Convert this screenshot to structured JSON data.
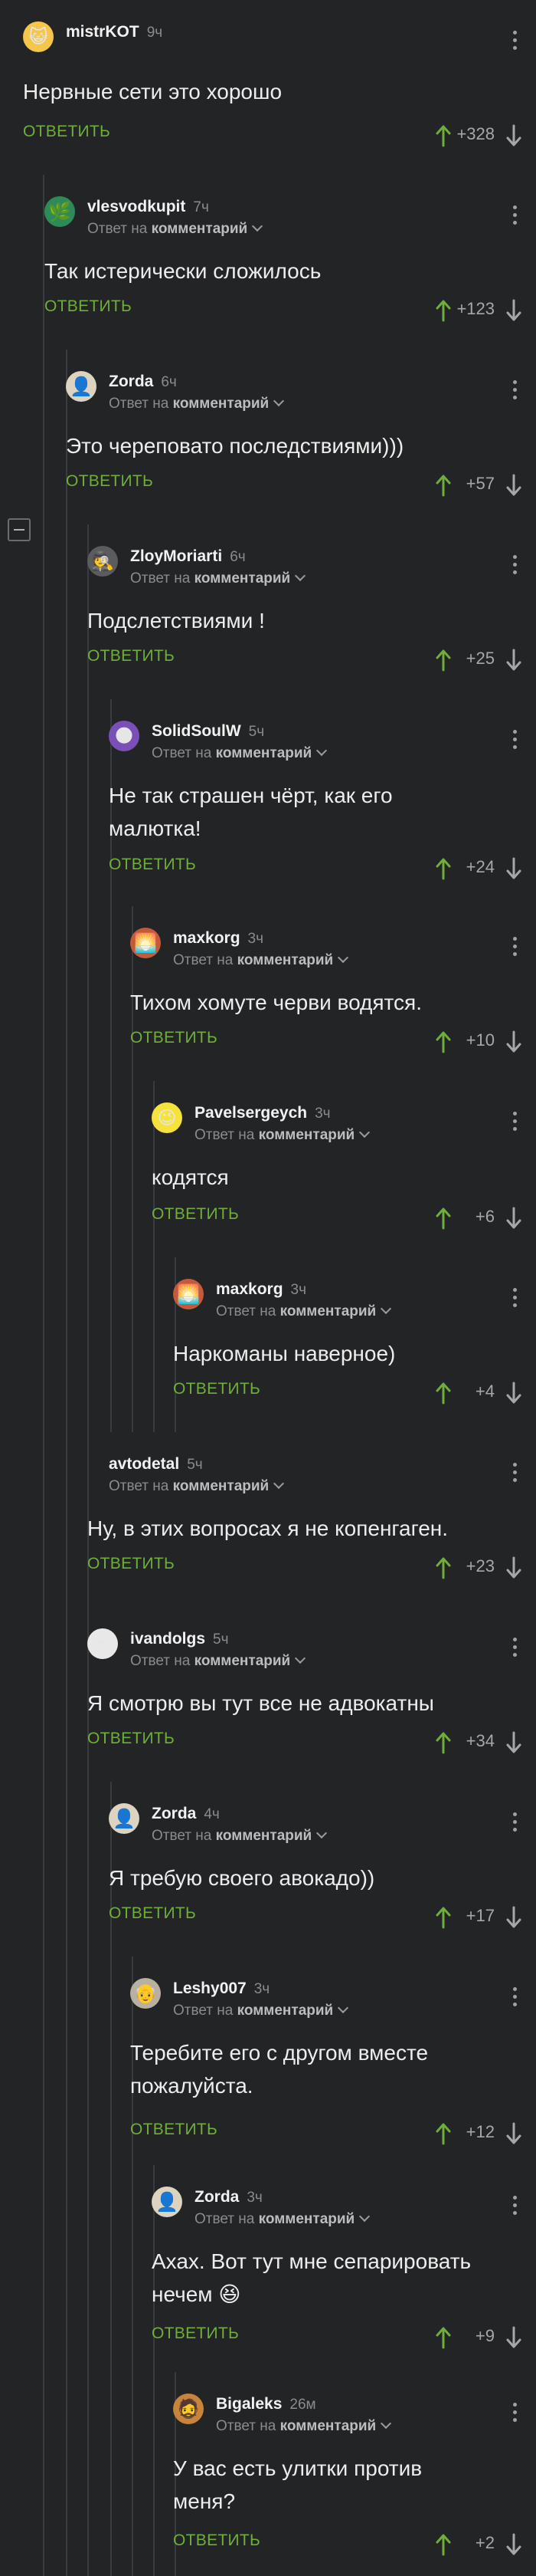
{
  "ui": {
    "reply_label": "ОТВЕТИТЬ",
    "reply_prefix": "Ответ на",
    "reply_target": "комментарий",
    "accent_color": "#6fae3a"
  },
  "comments": [
    {
      "user": "mistrKOT",
      "time": "9ч",
      "text": "Нервные сети это хорошо",
      "score": "+328",
      "reply_line": false
    },
    {
      "user": "vlesvodkupit",
      "time": "7ч",
      "text": "Так истерически сложилось",
      "score": "+123",
      "reply_line": true
    },
    {
      "user": "Zorda",
      "time": "6ч",
      "text": "Это череповато последствиями)))",
      "score": "+57",
      "reply_line": true
    },
    {
      "user": "ZloyMoriarti",
      "time": "6ч",
      "text": "Подслетствиями !",
      "score": "+25",
      "reply_line": true
    },
    {
      "user": "SolidSoulW",
      "time": "5ч",
      "text": "Не так страшен чёрт, как его малютка!",
      "score": "+24",
      "reply_line": true
    },
    {
      "user": "maxkorg",
      "time": "3ч",
      "text": "Тихом хомуте черви водятся.",
      "score": "+10",
      "reply_line": true
    },
    {
      "user": "Pavelsergeych",
      "time": "3ч",
      "text": "кодятся",
      "score": "+6",
      "reply_line": true
    },
    {
      "user": "maxkorg",
      "time": "3ч",
      "text": "Наркоманы наверное)",
      "score": "+4",
      "reply_line": true
    },
    {
      "user": "avtodetal",
      "time": "5ч",
      "text": "Ну, в этих вопросах я не копенгаген.",
      "score": "+23",
      "reply_line": true
    },
    {
      "user": "ivandolgs",
      "time": "5ч",
      "text": "Я смотрю вы тут все не адвокатны",
      "score": "+34",
      "reply_line": true
    },
    {
      "user": "Zorda",
      "time": "4ч",
      "text": "Я требую своего авокадо))",
      "score": "+17",
      "reply_line": true
    },
    {
      "user": "Leshy007",
      "time": "3ч",
      "text": "Теребите его с другом вместе пожалуйста.",
      "score": "+12",
      "reply_line": true
    },
    {
      "user": "Zorda",
      "time": "3ч",
      "text": "Ахах. Вот тут мне сепарировать нечем 😆",
      "score": "+9",
      "reply_line": true
    },
    {
      "user": "Bigaleks",
      "time": "26м",
      "text": "У вас есть улитки против меня?",
      "score": "+2",
      "reply_line": true
    }
  ]
}
